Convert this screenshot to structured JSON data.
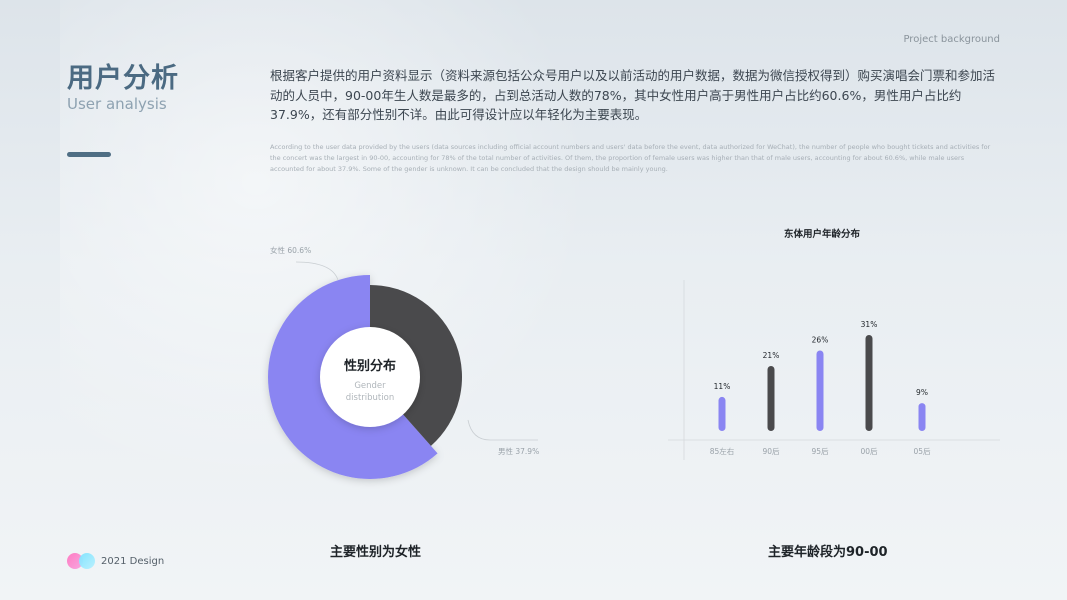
{
  "header": {
    "section_label": "Project background",
    "title_cn": "用户分析",
    "title_en": "User analysis"
  },
  "description": {
    "cn": "根据客户提供的用户资料显示（资料来源包括公众号用户以及以前活动的用户数据，数据为微信授权得到）购买演唱会门票和参加活动的人员中，90-00年生人数是最多的，占到总活动人数的78%，其中女性用户高于男性用户占比约60.6%，男性用户占比约37.9%，还有部分性别不详。由此可得设计应以年轻化为主要表现。",
    "en": "According to the user data provided by the users (data sources including official account numbers and users' data before the event, data authorized for WeChat), the number of people who bought tickets and activities for the concert was the largest in 90-00, accounting for 78% of the total number of activities. Of them, the proportion of female users was higher than that of male users, accounting for about 60.6%, while male users accounted for about 37.9%. Some of the gender is unknown. It can be concluded that the design should be mainly young."
  },
  "chart_data": [
    {
      "type": "pie",
      "title": "性别分布",
      "subtitle": "Gender distribution",
      "slices": [
        {
          "label": "女性 60.6%",
          "value": 60.6,
          "color": "#8a85f2"
        },
        {
          "label": "男性 37.9%",
          "value": 37.9,
          "color": "#4a4a4c"
        }
      ],
      "conclusion": "主要性别为女性"
    },
    {
      "type": "bar",
      "title": "东体用户年龄分布",
      "categories": [
        "85左右",
        "90后",
        "95后",
        "00后",
        "05后"
      ],
      "values": [
        11,
        21,
        26,
        31,
        9
      ],
      "value_labels": [
        "11%",
        "21%",
        "26%",
        "31%",
        "9%"
      ],
      "colors": [
        "#8a85f2",
        "#4a4a4c",
        "#8a85f2",
        "#4a4a4c",
        "#8a85f2"
      ],
      "ylim": [
        0,
        31
      ],
      "conclusion": "主要年龄段为90-00"
    }
  ],
  "footer": {
    "text": "2021 Design"
  }
}
